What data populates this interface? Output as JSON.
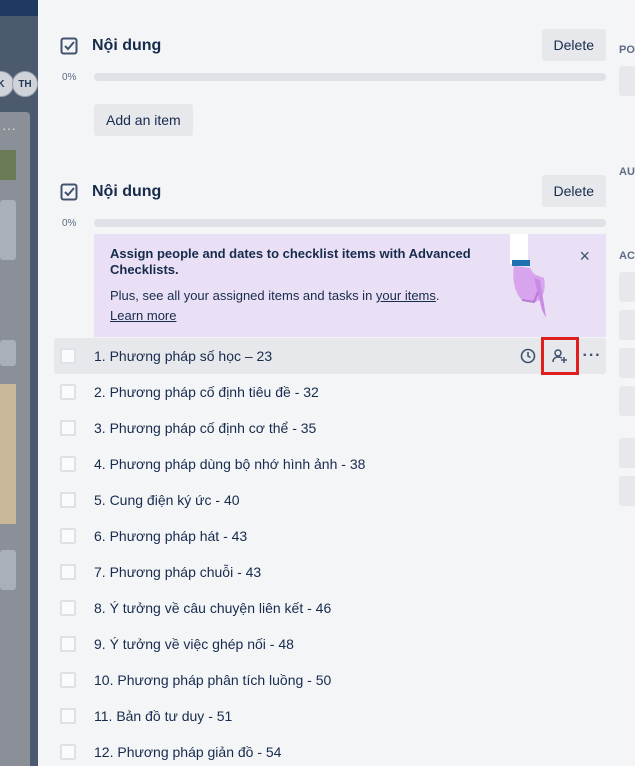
{
  "background": {
    "avatars": [
      "K",
      "TH"
    ],
    "list_menu": "···"
  },
  "right_panel": {
    "labels": [
      "PO",
      "AU",
      "AC"
    ]
  },
  "checklist_1": {
    "title": "Nội dung",
    "delete_label": "Delete",
    "percent": "0%",
    "progress": 0,
    "add_item_label": "Add an item"
  },
  "checklist_2": {
    "title": "Nội dung",
    "delete_label": "Delete",
    "percent": "0%",
    "progress": 0,
    "promo": {
      "title": "Assign people and dates to checklist items with Advanced Checklists.",
      "body_prefix": "Plus, see all your assigned items and tasks in ",
      "body_link": "your items",
      "body_suffix": ".",
      "learn_more": "Learn more",
      "close": "×"
    },
    "items": [
      "1. Phương pháp số học – 23",
      "2. Phương pháp cố định tiêu đề - 32",
      "3. Phương pháp cố định cơ thể - 35",
      "4. Phương pháp dùng bộ nhớ hình ảnh - 38",
      "5. Cung điện ký ức - 40",
      "6. Phương pháp hát - 43",
      "7. Phương pháp chuỗi - 43",
      "8. Ý tưởng về câu chuyện liên kết - 46",
      "9. Ý tưởng về việc ghép nối - 48",
      "10. Phương pháp phân tích luồng - 50",
      "11. Bản đồ tư duy - 51",
      "12. Phương pháp giản đồ - 54"
    ],
    "more_actions": "···"
  },
  "colors": {
    "highlight": "#e01e1e",
    "promo_bg": "#eae0f5"
  }
}
